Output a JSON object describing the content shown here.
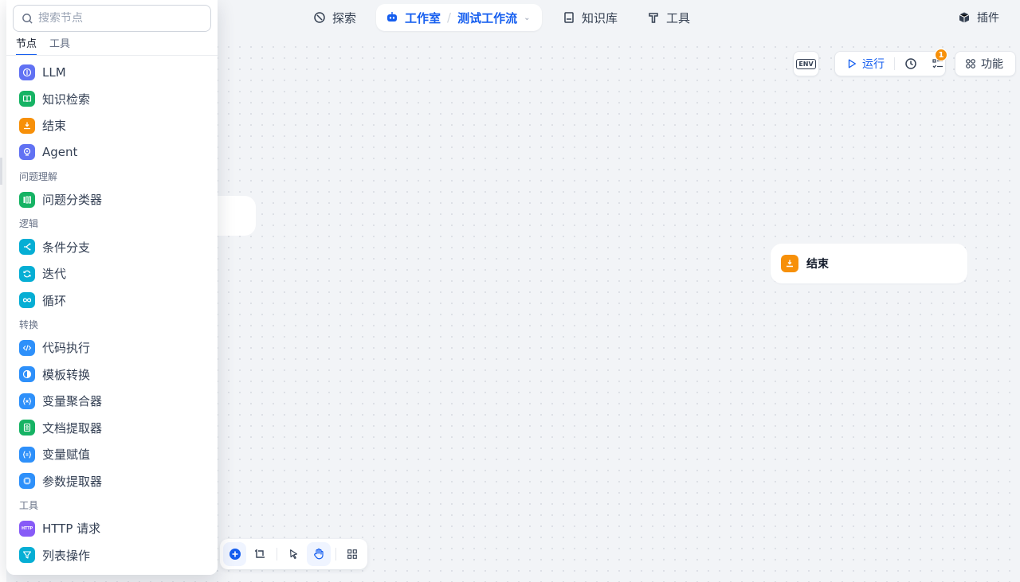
{
  "topnav": {
    "explore": "探索",
    "studio": "工作室",
    "workflow_name": "测试工作流",
    "knowledge": "知识库",
    "tools": "工具",
    "plugins": "插件"
  },
  "toolbar": {
    "env": "ENV",
    "run": "运行",
    "badge_count": "1",
    "features": "功能"
  },
  "canvas": {
    "end_node_label": "结束"
  },
  "panel": {
    "search_placeholder": "搜索节点",
    "tabs": [
      "节点",
      "工具"
    ],
    "items": {
      "llm": "LLM",
      "knowledge_retrieval": "知识检索",
      "end": "结束",
      "agent": "Agent",
      "group_qa": "问题理解",
      "question_classifier": "问题分类器",
      "group_logic": "逻辑",
      "if_else": "条件分支",
      "iteration": "迭代",
      "loop": "循环",
      "group_transform": "转换",
      "code": "代码执行",
      "template": "模板转换",
      "variable_aggregator": "变量聚合器",
      "doc_extractor": "文档提取器",
      "variable_assign": "变量赋值",
      "param_extractor": "参数提取器",
      "group_tools": "工具",
      "http": "HTTP 请求",
      "list_op": "列表操作"
    },
    "http_icon_text": "HTTP"
  },
  "colors": {
    "accent": "#155eef",
    "indigo": "#6172f3",
    "green": "#16b364",
    "orange": "#f79009",
    "cyan": "#06aed4",
    "blue": "#2e90fa",
    "violet": "#875bf7",
    "teal": "#15b79e"
  }
}
